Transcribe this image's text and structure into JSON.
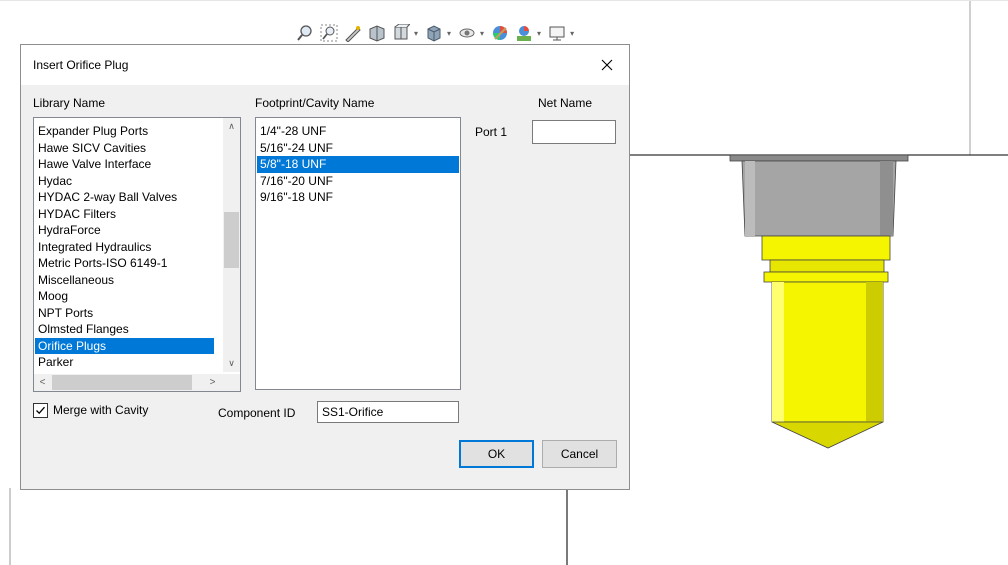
{
  "toolbar": {
    "icons": [
      "zoom-icon",
      "zoom-window-icon",
      "pan-icon",
      "view-orient-icon",
      "section-view-icon",
      "display-style-icon",
      "hide-show-icon",
      "appearance-icon",
      "scene-icon",
      "display-icon"
    ]
  },
  "dialog": {
    "title": "Insert Orifice Plug",
    "close_glyph": "✕",
    "library_label": "Library Name",
    "footprint_label": "Footprint/Cavity Name",
    "netname_label": "Net Name",
    "port_label": "Port 1",
    "netname_value": "",
    "libraries": [
      "Expander Plug Ports",
      "Hawe SICV Cavities",
      "Hawe Valve Interface",
      "Hydac",
      "HYDAC 2-way Ball Valves",
      "HYDAC Filters",
      "HydraForce",
      "Integrated Hydraulics",
      "Metric Ports-ISO 6149-1",
      "Miscellaneous",
      "Moog",
      "NPT Ports",
      "Olmsted Flanges",
      "Orifice Plugs",
      "Parker"
    ],
    "selected_library": "Orifice Plugs",
    "footprints": [
      "1/4\"-28 UNF",
      "5/16\"-24 UNF",
      "5/8\"-18 UNF",
      "7/16\"-20 UNF",
      "9/16\"-18 UNF"
    ],
    "selected_footprint": "5/8\"-18 UNF",
    "merge_label": "Merge with Cavity",
    "merge_checked": true,
    "component_id_label": "Component ID",
    "component_id_value": "SS1-Orifice",
    "ok_label": "OK",
    "cancel_label": "Cancel",
    "scroll_up": "∧",
    "scroll_down": "∨",
    "scroll_left": "<",
    "scroll_right": ">"
  },
  "colors": {
    "selection": "#0078d7",
    "plug_yellow": "#f5f500",
    "plug_grey": "#a0a0a0"
  }
}
